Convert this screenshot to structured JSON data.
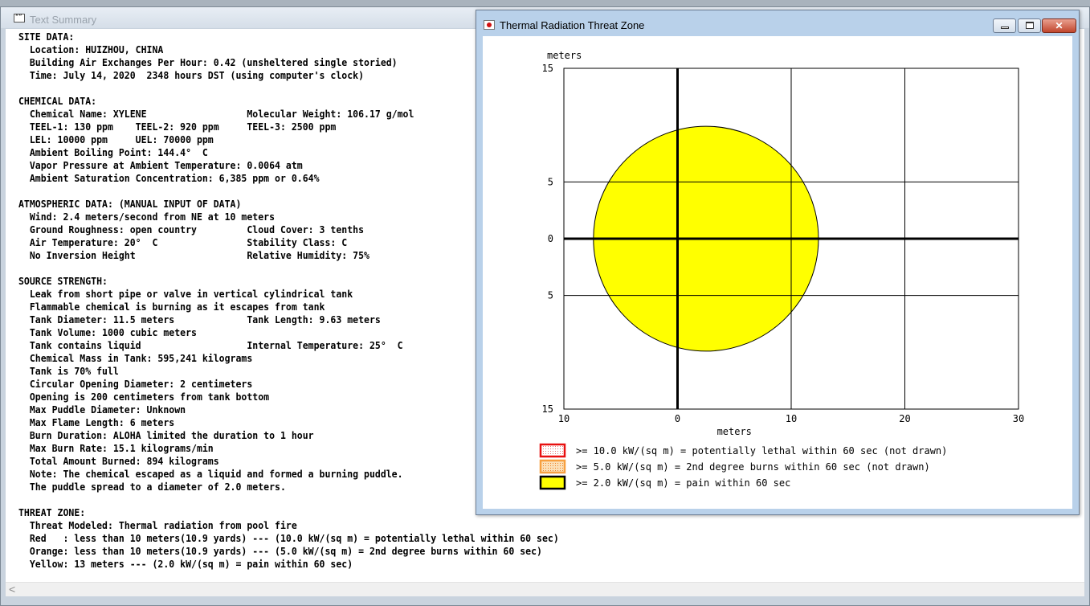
{
  "text_summary": {
    "title": "Text Summary",
    "lines": [
      "SITE DATA:",
      "  Location: HUIZHOU, CHINA",
      "  Building Air Exchanges Per Hour: 0.42 (unsheltered single storied)",
      "  Time: July 14, 2020  2348 hours DST (using computer's clock)",
      "",
      "CHEMICAL DATA:",
      "  Chemical Name: XYLENE                  Molecular Weight: 106.17 g/mol",
      "  TEEL-1: 130 ppm    TEEL-2: 920 ppm     TEEL-3: 2500 ppm",
      "  LEL: 10000 ppm     UEL: 70000 ppm",
      "  Ambient Boiling Point: 144.4°  C",
      "  Vapor Pressure at Ambient Temperature: 0.0064 atm",
      "  Ambient Saturation Concentration: 6,385 ppm or 0.64%",
      "",
      "ATMOSPHERIC DATA: (MANUAL INPUT OF DATA)",
      "  Wind: 2.4 meters/second from NE at 10 meters",
      "  Ground Roughness: open country         Cloud Cover: 3 tenths",
      "  Air Temperature: 20°  C                Stability Class: C",
      "  No Inversion Height                    Relative Humidity: 75%",
      "",
      "SOURCE STRENGTH:",
      "  Leak from short pipe or valve in vertical cylindrical tank",
      "  Flammable chemical is burning as it escapes from tank",
      "  Tank Diameter: 11.5 meters             Tank Length: 9.63 meters",
      "  Tank Volume: 1000 cubic meters",
      "  Tank contains liquid                   Internal Temperature: 25°  C",
      "  Chemical Mass in Tank: 595,241 kilograms",
      "  Tank is 70% full",
      "  Circular Opening Diameter: 2 centimeters",
      "  Opening is 200 centimeters from tank bottom",
      "  Max Puddle Diameter: Unknown",
      "  Max Flame Length: 6 meters",
      "  Burn Duration: ALOHA limited the duration to 1 hour",
      "  Max Burn Rate: 15.1 kilograms/min",
      "  Total Amount Burned: 894 kilograms",
      "  Note: The chemical escaped as a liquid and formed a burning puddle.",
      "  The puddle spread to a diameter of 2.0 meters.",
      "",
      "THREAT ZONE:",
      "  Threat Modeled: Thermal radiation from pool fire",
      "  Red   : less than 10 meters(10.9 yards) --- (10.0 kW/(sq m) = potentially lethal within 60 sec)",
      "  Orange: less than 10 meters(10.9 yards) --- (5.0 kW/(sq m) = 2nd degree burns within 60 sec)",
      "  Yellow: 13 meters --- (2.0 kW/(sq m) = pain within 60 sec)"
    ],
    "scroll_left_icon": "<"
  },
  "threat_window": {
    "title": "Thermal Radiation Threat Zone"
  },
  "chart_data": {
    "type": "scatter",
    "title": "",
    "xlabel": "meters",
    "ylabel": "meters",
    "xlim": [
      -10,
      30
    ],
    "ylim": [
      -15,
      15
    ],
    "x_ticks": [
      -10,
      0,
      10,
      20,
      30
    ],
    "x_tick_labels": [
      "10",
      "0",
      "10",
      "20",
      "30"
    ],
    "y_ticks": [
      15,
      5,
      0,
      -5,
      -15
    ],
    "y_tick_labels": [
      "15",
      "5",
      "0",
      "5",
      "15"
    ],
    "grid": true,
    "zones": [
      {
        "name": "yellow",
        "shape": "ellipse",
        "center": [
          2.5,
          0
        ],
        "radius": 9.9,
        "color": "#ffff00",
        "drawn": true
      }
    ],
    "legend": [
      {
        "label": ">= 10.0 kW/(sq m) = potentially lethal within 60 sec (not drawn)",
        "color": "#e81010",
        "fill": "dotted"
      },
      {
        "label": ">= 5.0 kW/(sq m) = 2nd degree burns within 60 sec (not drawn)",
        "color": "#f7a040",
        "fill": "dotted"
      },
      {
        "label": ">= 2.0 kW/(sq m) = pain within 60 sec",
        "color": "#ffff00",
        "fill": "solid"
      }
    ],
    "legend_position": "bottom"
  }
}
